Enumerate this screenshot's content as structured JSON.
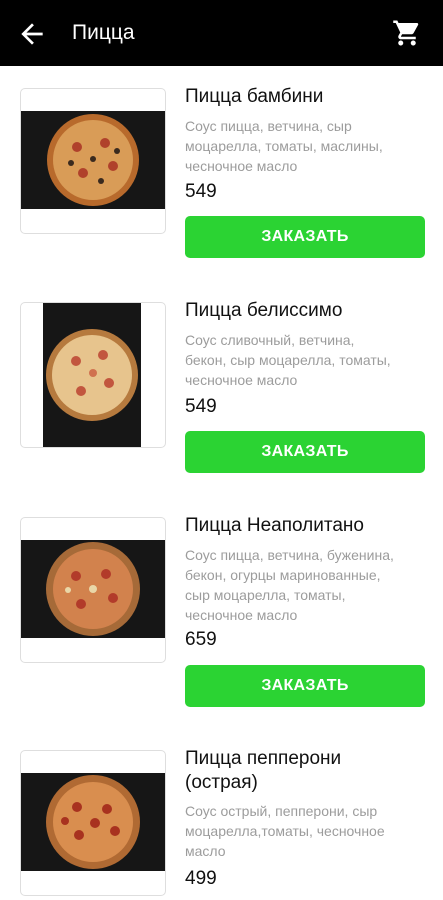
{
  "header": {
    "title": "Пицца",
    "back_icon": "arrow-left-icon",
    "cart_icon": "shopping-cart-icon"
  },
  "colors": {
    "appbar": "#000000",
    "order_button": "#2bd333"
  },
  "items": [
    {
      "name": "Пицца бамбини",
      "desc_lines": [
        "Соус пицца, ветчина, сыр",
        "моцарелла, томаты, маслины,",
        "чесночное масло"
      ],
      "price": "549",
      "button": "ЗАКАЗАТЬ"
    },
    {
      "name": "Пицца белиссимо",
      "desc_lines": [
        "Соус сливочный, ветчина,",
        "бекон, сыр моцарелла, томаты,",
        "чесночное масло"
      ],
      "price": "549",
      "button": "ЗАКАЗАТЬ"
    },
    {
      "name": "Пицца Неаполитано",
      "desc_lines": [
        "Соус пицца, ветчина, буженина,",
        "бекон, огурцы маринованные,",
        "сыр моцарелла, томаты,",
        "чесночное масло"
      ],
      "price": "659",
      "button": "ЗАКАЗАТЬ"
    },
    {
      "name_lines": [
        "Пицца пепперони",
        "(острая)"
      ],
      "desc_lines": [
        "Соус острый, пепперони, сыр",
        "моцарелла,томаты, чесночное",
        "масло"
      ],
      "price": "499"
    }
  ]
}
